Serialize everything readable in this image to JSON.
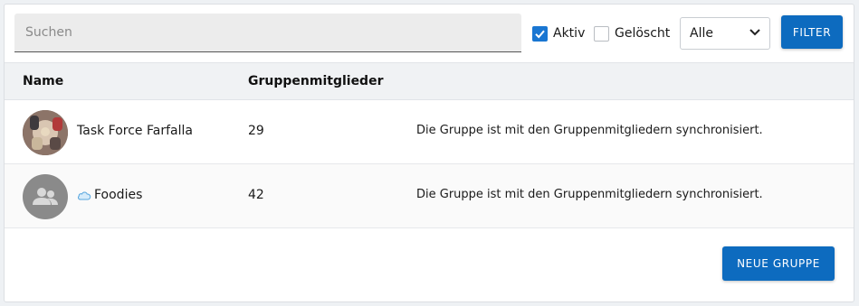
{
  "toolbar": {
    "search_placeholder": "Suchen",
    "checkbox_active": {
      "label": "Aktiv",
      "checked": true
    },
    "checkbox_deleted": {
      "label": "Gelöscht",
      "checked": false
    },
    "select_value": "Alle",
    "filter_label": "FILTER"
  },
  "table": {
    "headers": {
      "name": "Name",
      "members": "Gruppenmitglieder"
    },
    "rows": [
      {
        "name": "Task Force Farfalla",
        "members": "29",
        "status": "Die Gruppe ist mit den Gruppenmitgliedern synchronisiert.",
        "avatar": "photo-avatar",
        "cloud": false
      },
      {
        "name": "Foodies",
        "members": "42",
        "status": "Die Gruppe ist mit den Gruppenmitgliedern synchronisiert.",
        "avatar": "group-icon",
        "cloud": true
      }
    ]
  },
  "footer": {
    "new_group_label": "NEUE GRUPPE"
  },
  "colors": {
    "accent": "#0d6bbf",
    "header_bg": "#f0f2f4",
    "search_bg": "#ececec"
  }
}
